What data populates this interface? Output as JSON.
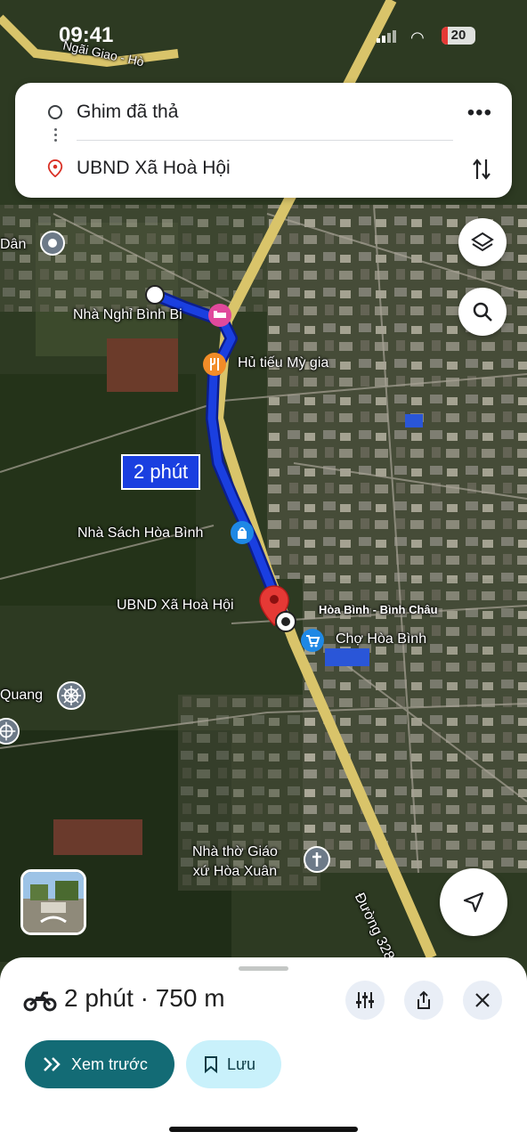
{
  "status_bar": {
    "time": "09:41",
    "battery": "20"
  },
  "route": {
    "origin": "Ghim đã thả",
    "destination": "UBND Xã Hoà Hội"
  },
  "map": {
    "labels": {
      "dan": "Dân",
      "nha_nghi": "Nhà Nghỉ Bình Bi",
      "hu_tieu": "Hủ tiếu Mỳ gia",
      "route_time": "2 phút",
      "nha_sach": "Nhà Sách Hòa Bình",
      "ubnd": "UBND Xã Hoà Hội",
      "hoa_binh_binh_chau": "Hòa Bình - Bình Châu",
      "cho": "Chợ Hòa Bình",
      "quang": "Quang",
      "nha_tho_line1": "Nhà thờ Giáo",
      "nha_tho_line2": "xứ Hòa Xuân",
      "duong": "Đường 328",
      "ngai_giao": "Ngãi Giao - Hò"
    },
    "colors": {
      "route": "#1a3fe0",
      "road": "#d9c46a",
      "pin": "#e53935"
    }
  },
  "sheet": {
    "trip_summary": "2 phút · 750 m",
    "preview_label": "Xem trước",
    "save_label": "Lưu"
  }
}
